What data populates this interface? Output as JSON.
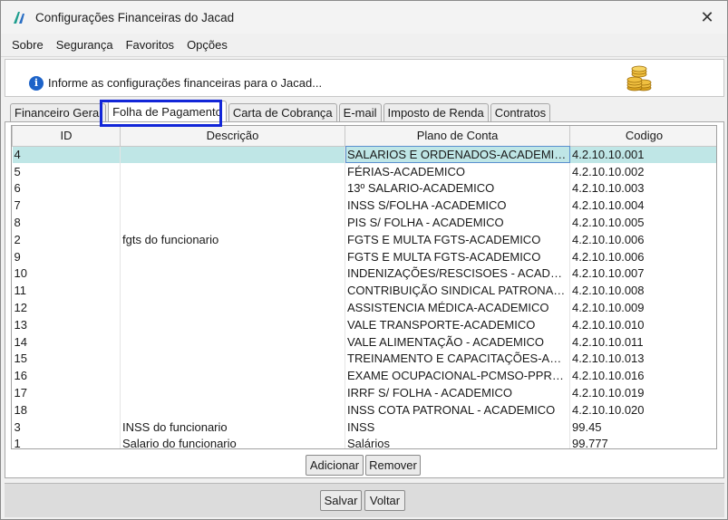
{
  "window": {
    "title": "Configurações Financeiras do Jacad"
  },
  "icons": {
    "app": "jacad-logo-icon",
    "close": "close-icon",
    "info": "info-icon",
    "coins": "coins-icon"
  },
  "menu": [
    "Sobre",
    "Segurança",
    "Favoritos",
    "Opções"
  ],
  "info": {
    "text": "Informe as configurações financeiras para o Jacad..."
  },
  "tabs": [
    "Financeiro Geral",
    "Folha de Pagamento",
    "Carta de Cobrança",
    "E-mail",
    "Imposto de Renda",
    "Contratos"
  ],
  "active_tab": "Folha de Pagamento",
  "colors": {
    "highlight": "#1226d8",
    "selected_row": "#bfe6e6",
    "info_blue": "#1e63c8"
  },
  "grid": {
    "columns": [
      "ID",
      "Descrição",
      "Plano de Conta",
      "Codigo"
    ],
    "rows": [
      [
        "4",
        "",
        "SALARIOS E ORDENADOS-ACADEMICO",
        "4.2.10.10.001"
      ],
      [
        "5",
        "",
        "FÉRIAS-ACADEMICO",
        "4.2.10.10.002"
      ],
      [
        "6",
        "",
        "13º SALARIO-ACADEMICO",
        "4.2.10.10.003"
      ],
      [
        "7",
        "",
        "INSS S/FOLHA -ACADEMICO",
        "4.2.10.10.004"
      ],
      [
        "8",
        "",
        "PIS S/ FOLHA - ACADEMICO",
        "4.2.10.10.005"
      ],
      [
        "2",
        "fgts do funcionario",
        "FGTS E MULTA FGTS-ACADEMICO",
        "4.2.10.10.006"
      ],
      [
        "9",
        "",
        "FGTS E MULTA FGTS-ACADEMICO",
        "4.2.10.10.006"
      ],
      [
        "10",
        "",
        "INDENIZAÇÕES/RESCISOES - ACADEMICO",
        "4.2.10.10.007"
      ],
      [
        "11",
        "",
        "CONTRIBUIÇÃO SINDICAL PATRONAL E T...",
        "4.2.10.10.008"
      ],
      [
        "12",
        "",
        "ASSISTENCIA MÉDICA-ACADEMICO",
        "4.2.10.10.009"
      ],
      [
        "13",
        "",
        "VALE TRANSPORTE-ACADEMICO",
        "4.2.10.10.010"
      ],
      [
        "14",
        "",
        "VALE ALIMENTAÇÃO - ACADEMICO",
        "4.2.10.10.011"
      ],
      [
        "15",
        "",
        "TREINAMENTO E CAPACITAÇÕES-ACADE...",
        "4.2.10.10.013"
      ],
      [
        "16",
        "",
        "EXAME OCUPACIONAL-PCMSO-PPRA-LTC...",
        "4.2.10.10.016"
      ],
      [
        "17",
        "",
        "IRRF S/ FOLHA - ACADEMICO",
        "4.2.10.10.019"
      ],
      [
        "18",
        "",
        "INSS COTA PATRONAL - ACADEMICO",
        "4.2.10.10.020"
      ],
      [
        "3",
        "INSS do funcionario",
        "INSS",
        "99.45"
      ],
      [
        "1",
        "Salario do funcionario",
        "Salários",
        "99.777"
      ]
    ],
    "selected_row": 0
  },
  "buttons": {
    "add": "Adicionar",
    "remove": "Remover",
    "save": "Salvar",
    "back": "Voltar"
  }
}
